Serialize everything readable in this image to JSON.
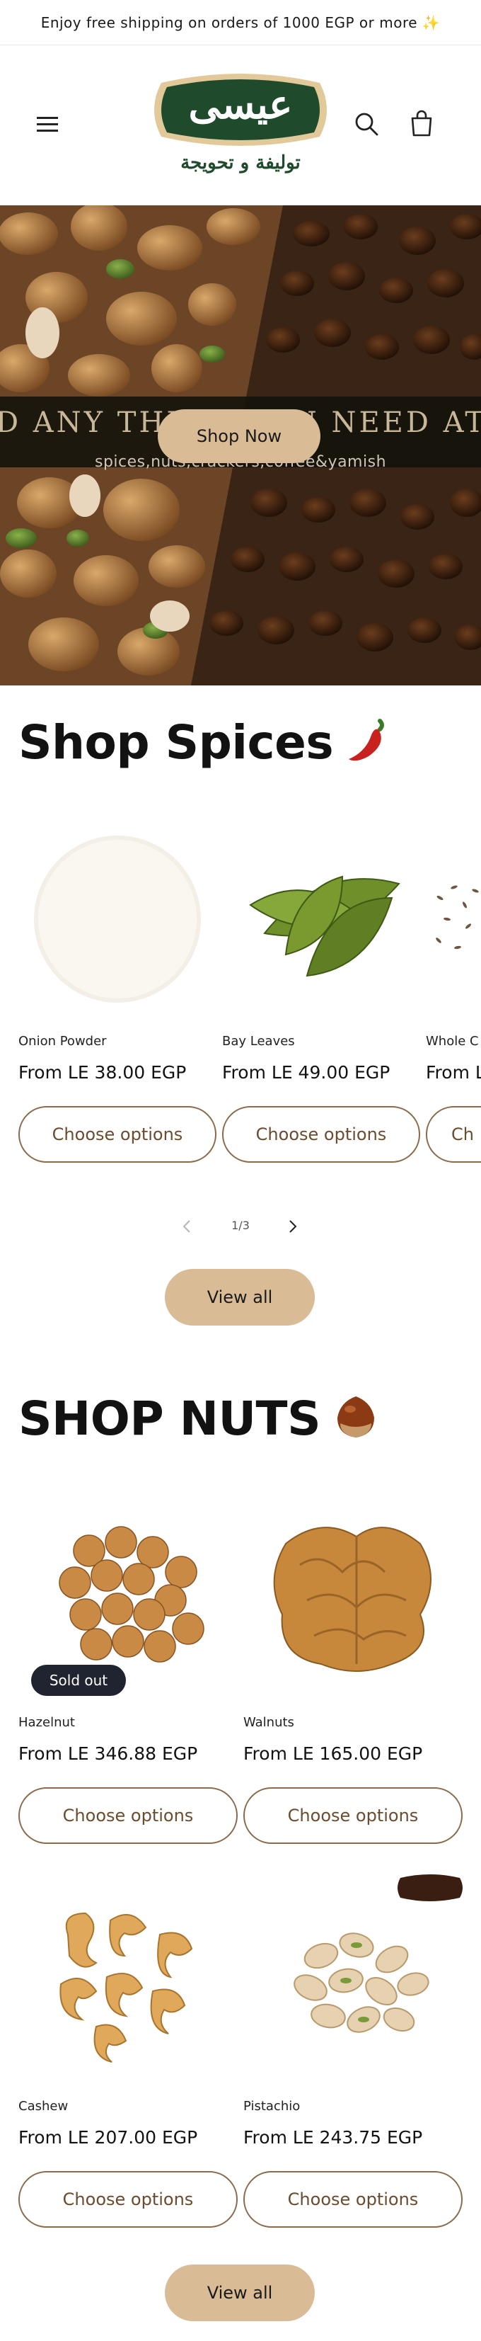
{
  "announcement": {
    "text": "Enjoy free shipping on orders of 1000 EGP or more ✨"
  },
  "header": {
    "logo_arabic": "عيسى",
    "logo_tagline": "توليفة و تحويجة"
  },
  "hero": {
    "marquee": "D ANY THING YOU NEED AT EISSA",
    "subtitle": "spices,nuts,crackers,coffee&yamish",
    "cta_label": "Shop Now"
  },
  "spices": {
    "title": "Shop Spices",
    "title_emoji": "🌶️",
    "products": [
      {
        "name": "Onion Powder",
        "price": "From LE 38.00 EGP",
        "cta": "Choose options"
      },
      {
        "name": "Bay Leaves",
        "price": "From LE 49.00 EGP",
        "cta": "Choose options"
      },
      {
        "name": "Whole C",
        "price": "From L",
        "cta": "Ch"
      }
    ],
    "pagination": "1/3",
    "view_all": "View all"
  },
  "nuts": {
    "title": "SHOP NUTS",
    "title_emoji": "🌰",
    "sold_out_label": "Sold out",
    "products": [
      {
        "name": "Hazelnut",
        "price": "From LE 346.88 EGP",
        "cta": "Choose options"
      },
      {
        "name": "Walnuts",
        "price": "From LE 165.00 EGP",
        "cta": "Choose options"
      },
      {
        "name": "Cashew",
        "price": "From LE 207.00 EGP",
        "cta": "Choose options"
      },
      {
        "name": "Pistachio",
        "price": "From LE 243.75 EGP",
        "cta": "Choose options"
      }
    ],
    "view_all": "View all"
  },
  "colors": {
    "brand_green": "#1f4b2c",
    "accent_tan": "#d9bb95",
    "outline_brown": "#8a6a4a"
  },
  "icons": [
    "menu-icon",
    "search-icon",
    "cart-icon",
    "chevron-left-icon",
    "chevron-right-icon"
  ]
}
